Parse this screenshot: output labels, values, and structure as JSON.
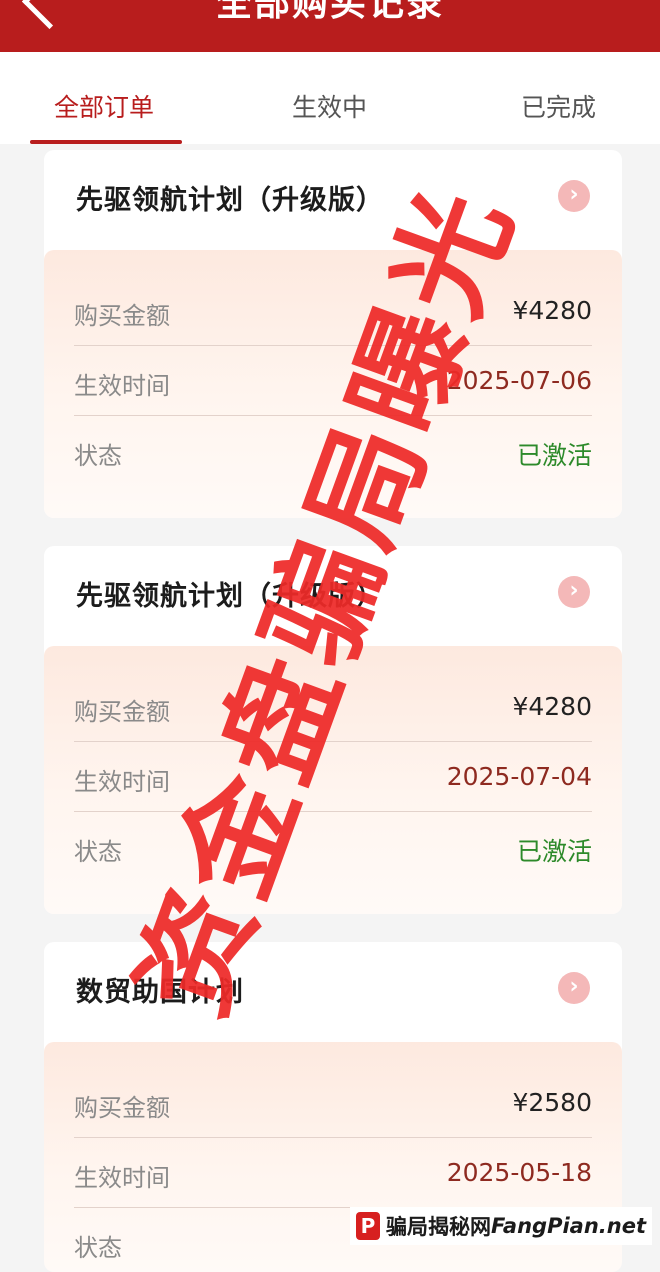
{
  "header": {
    "title": "全部购买记录"
  },
  "tabs": [
    {
      "label": "全部订单"
    },
    {
      "label": "生效中"
    },
    {
      "label": "已完成"
    }
  ],
  "orders": [
    {
      "title": "先驱领航计划（升级版）",
      "rows": [
        {
          "label": "购买金额",
          "value": "¥4280"
        },
        {
          "label": "生效时间",
          "value": "2025-07-06"
        },
        {
          "label": "状态",
          "value": "已激活"
        }
      ]
    },
    {
      "title": "先驱领航计划（升级版）",
      "rows": [
        {
          "label": "购买金额",
          "value": "¥4280"
        },
        {
          "label": "生效时间",
          "value": "2025-07-04"
        },
        {
          "label": "状态",
          "value": "已激活"
        }
      ]
    },
    {
      "title": "数贸助国计划",
      "rows": [
        {
          "label": "购买金额",
          "value": "¥2580"
        },
        {
          "label": "生效时间",
          "value": "2025-05-18"
        },
        {
          "label": "状态",
          "value": ""
        }
      ]
    }
  ],
  "watermark": {
    "text": "资金盘骗局曝光"
  },
  "footer": {
    "logo_text": "骗局揭秘网",
    "site": "FangPian.net"
  },
  "colors": {
    "brand_red": "#b81d1d",
    "status_active": "#2d8a2a",
    "date_value": "#8e2a20",
    "watermark": "#ee2a28"
  },
  "icons": {
    "back": "chevron-left-icon",
    "card_arrow": "chevron-right-circle-icon"
  }
}
